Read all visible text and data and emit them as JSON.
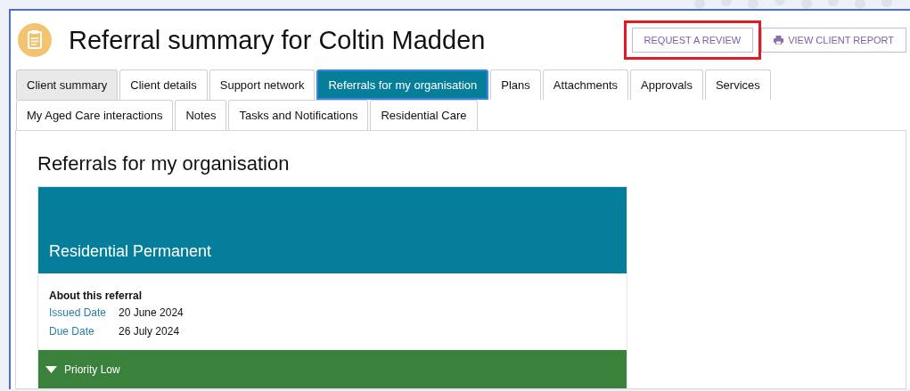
{
  "header": {
    "title": "Referral summary for Coltin Madden"
  },
  "actions": [
    {
      "label": "REQUEST A REVIEW",
      "kind": "plain",
      "highlighted": true
    },
    {
      "label": "VIEW CLIENT REPORT",
      "kind": "print",
      "highlighted": false
    }
  ],
  "tab_rows": [
    [
      {
        "label": "Client summary",
        "selected": false,
        "shaded": true
      },
      {
        "label": "Client details",
        "selected": false,
        "shaded": false
      },
      {
        "label": "Support network",
        "selected": false,
        "shaded": false
      },
      {
        "label": "Referrals for my organisation",
        "selected": true,
        "shaded": false
      },
      {
        "label": "Plans",
        "selected": false,
        "shaded": false
      },
      {
        "label": "Attachments",
        "selected": false,
        "shaded": false
      },
      {
        "label": "Approvals",
        "selected": false,
        "shaded": false
      },
      {
        "label": "Services",
        "selected": false,
        "shaded": false
      }
    ],
    [
      {
        "label": "My Aged Care interactions",
        "selected": false,
        "shaded": false
      },
      {
        "label": "Notes",
        "selected": false,
        "shaded": false
      },
      {
        "label": "Tasks and Notifications",
        "selected": false,
        "shaded": false
      },
      {
        "label": "Residential Care",
        "selected": false,
        "shaded": false
      }
    ]
  ],
  "section": {
    "heading": "Referrals for my organisation",
    "card": {
      "title": "Residential Permanent",
      "about_heading": "About this referral",
      "fields": [
        {
          "label": "Issued Date",
          "value": "20 June 2024"
        },
        {
          "label": "Due Date",
          "value": "26 July 2024"
        }
      ],
      "priority": {
        "label": "Priority Low",
        "expanded": true
      }
    }
  }
}
